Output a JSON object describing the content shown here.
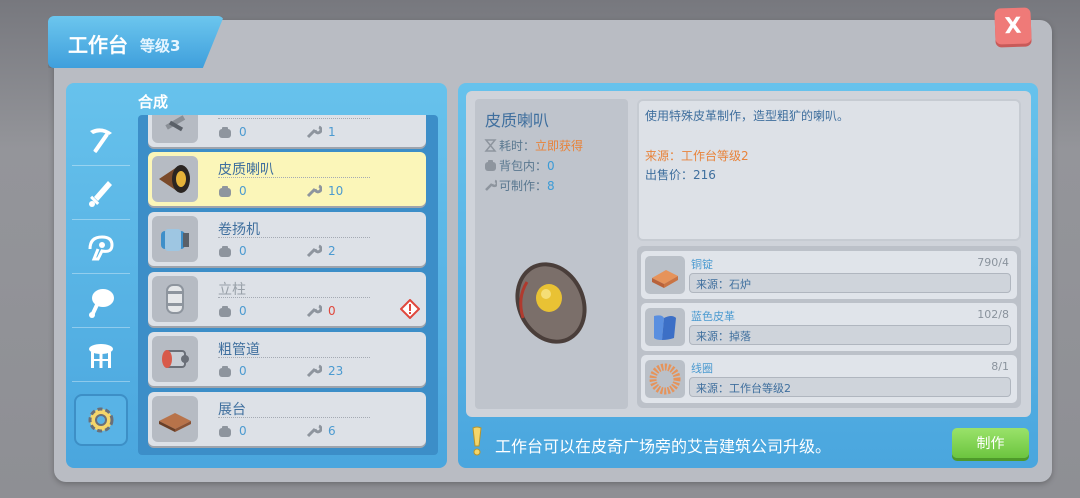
{
  "window": {
    "title": "工作台",
    "level": "等级3",
    "close_label": "X"
  },
  "left": {
    "section_label": "合成",
    "categories": [
      {
        "icon": "pickaxe-icon"
      },
      {
        "icon": "sword-icon"
      },
      {
        "icon": "chain-icon"
      },
      {
        "icon": "meat-icon"
      },
      {
        "icon": "stool-icon"
      },
      {
        "icon": "gear-icon",
        "active": true
      }
    ],
    "items": [
      {
        "name": "",
        "bag": "0",
        "craftable": "1",
        "icon": "tools-icon"
      },
      {
        "name": "皮质喇叭",
        "bag": "0",
        "craftable": "10",
        "icon": "horn-icon",
        "selected": true
      },
      {
        "name": "卷扬机",
        "bag": "0",
        "craftable": "2",
        "icon": "winch-icon"
      },
      {
        "name": "立柱",
        "bag": "0",
        "craftable": "0",
        "icon": "pillar-icon",
        "disabled": true,
        "warning": true
      },
      {
        "name": "粗管道",
        "bag": "0",
        "craftable": "23",
        "icon": "pipe-icon"
      },
      {
        "name": "展台",
        "bag": "0",
        "craftable": "6",
        "icon": "platform-icon"
      }
    ]
  },
  "detail": {
    "name": "皮质喇叭",
    "time_label": "耗时：",
    "time_value": "立即获得",
    "bag_label": "背包内：",
    "bag_value": "0",
    "craftable_label": "可制作：",
    "craftable_value": "8",
    "description": "使用特殊皮革制作，造型粗犷的喇叭。",
    "source": "来源：工作台等级2",
    "price": "出售价：216"
  },
  "materials": [
    {
      "name": "铜锭",
      "qty": "790/4",
      "source": "来源：石炉",
      "icon": "copper-ingot-icon"
    },
    {
      "name": "蓝色皮革",
      "qty": "102/8",
      "source": "来源：掉落",
      "icon": "blue-leather-icon"
    },
    {
      "name": "线圈",
      "qty": "8/1",
      "source": "来源：工作台等级2",
      "icon": "coil-icon"
    }
  ],
  "footer": {
    "tip": "工作台可以在皮奇广场旁的艾吉建筑公司升级。",
    "make_label": "制作"
  }
}
